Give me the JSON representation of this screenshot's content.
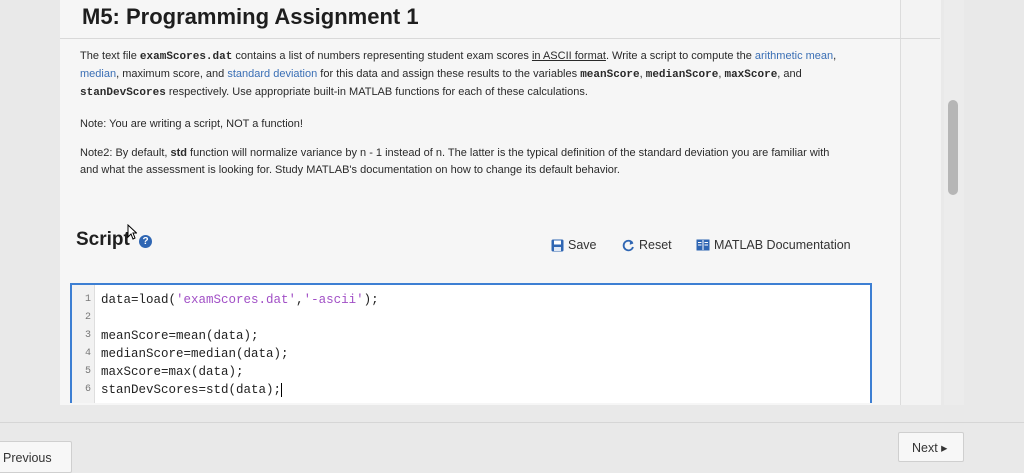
{
  "assignment": {
    "title": "M5: Programming Assignment 1"
  },
  "description": {
    "p1": {
      "t1": "The text file ",
      "filename": "examScores.dat",
      "t2": " contains a list of numbers representing student exam scores ",
      "ascii_link": "in ASCII format",
      "t3": ". Write a script to compute the ",
      "mean_link": "arithmetic mean",
      "sep1": ", ",
      "median_link": "median",
      "t4": ", maximum score, and ",
      "std_link": "standard deviation",
      "t5": " for this data and assign these results to the variables ",
      "var1": "meanScore",
      "sep2": ", ",
      "var2": "medianScore",
      "sep3": ", ",
      "var3": "maxScore",
      "t6": ", and ",
      "var4": "stanDevScores",
      "t7": " respectively. Use appropriate built-in MATLAB functions for each of these calculations."
    },
    "note1": "Note: You are writing a script, NOT a function!",
    "note2": {
      "t1": "Note2: By default, ",
      "fn": "std",
      "t2": " function will normalize variance by n - 1 instead of n. The latter is the typical definition of the standard deviation you are familiar with and what the assessment is looking for. Study MATLAB's documentation on how to change its default behavior."
    }
  },
  "script_panel": {
    "heading": "Script",
    "help_glyph": "?",
    "save_label": "Save",
    "reset_label": "Reset",
    "docs_label": "MATLAB Documentation"
  },
  "editor": {
    "lines": [
      {
        "num": "1",
        "pre": "data=load(",
        "s1": "'examScores.dat'",
        "mid": ",",
        "s2": "'-ascii'",
        "post": ");"
      },
      {
        "num": "2",
        "code": ""
      },
      {
        "num": "3",
        "code": "meanScore=mean(data);"
      },
      {
        "num": "4",
        "code": "medianScore=median(data);"
      },
      {
        "num": "5",
        "code": "maxScore=max(data);"
      },
      {
        "num": "6",
        "code": "stanDevScores=std(data);"
      }
    ]
  },
  "navigation": {
    "previous_label": "Previous",
    "next_label": "Next ▸"
  },
  "colors": {
    "link": "#3a6fb5",
    "editor_border": "#3d7fd3",
    "string_literal": "#a14fc6"
  }
}
